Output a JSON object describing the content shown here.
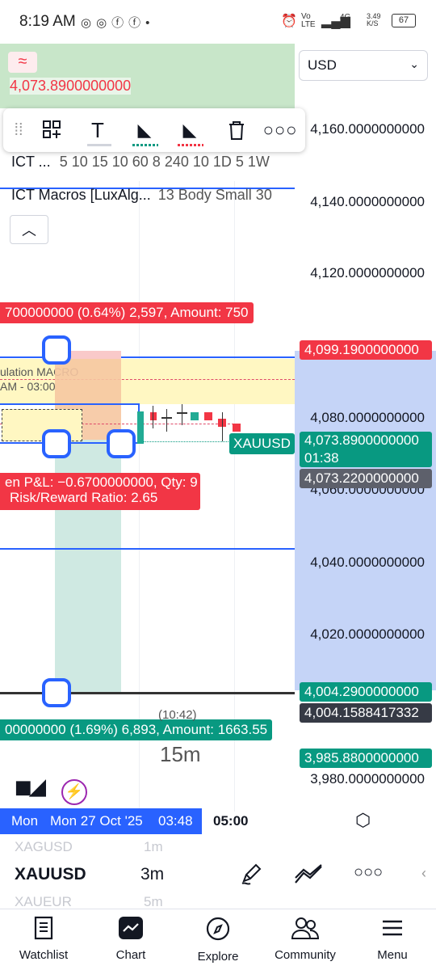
{
  "status": {
    "time": "8:19 AM",
    "network": "Vo LTE",
    "signal_type": "4G",
    "speed": "3.49 K/S",
    "battery": "67"
  },
  "chart": {
    "currency": "USD",
    "top_price_label": "4,073.8900000000",
    "indicator_row_1_name": "ICT ...",
    "indicator_row_1_params": "5 10 15 10 60 8 240 10 1D 5 1W",
    "indicator_row_2_name": "ICT Macros [LuxAlg...",
    "indicator_row_2_params": "13 Body Small 30",
    "price_ticks": [
      "4,160.0000000000",
      "4,140.0000000000",
      "4,120.0000000000",
      "4,080.0000000000",
      "4,060.0000000000",
      "4,040.0000000000",
      "4,020.0000000000",
      "3,980.0000000000"
    ],
    "tag_target": "4,099.1900000000",
    "tag_last": "4,073.8900000000",
    "tag_countdown": "01:38",
    "tag_entry": "4,073.2200000000",
    "tag_stop": "4,004.2900000000",
    "tag_stop_calc": "4,004.1588417332",
    "tag_low": "3,985.8800000000",
    "symbol_chip": "XAUUSD",
    "target_label": "700000000 (0.64%) 2,597, Amount: 750",
    "pnl_line_1": "en P&L: −0.6700000000, Qty: 9",
    "pnl_line_2": "Risk/Reward Ratio: 2.65",
    "stop_label": "00000000 (1.69%) 6,893, Amount: 1663.55",
    "macro_line_1": "ulation MACRO",
    "macro_line_2": "AM - 03:00",
    "timer_small": "(10:42)",
    "interval_watermark": "15m",
    "time_axis_1": "Mon",
    "time_axis_2": "Mon 27 Oct '25",
    "time_axis_3": "03:48",
    "time_axis_4": "05:00"
  },
  "symbol_bar": {
    "prev_symbol": "XAGUSD",
    "prev_interval": "1m",
    "symbol": "XAUUSD",
    "interval": "3m",
    "next_symbol": "XAUEUR",
    "next_interval": "5m"
  },
  "nav": [
    {
      "label": "Watchlist",
      "icon": "watchlist-icon"
    },
    {
      "label": "Chart",
      "icon": "chart-icon"
    },
    {
      "label": "Explore",
      "icon": "compass-icon"
    },
    {
      "label": "Community",
      "icon": "community-icon"
    },
    {
      "label": "Menu",
      "icon": "menu-icon"
    }
  ],
  "colors": {
    "accent_blue": "#2962ff",
    "bear_red": "#f23645",
    "bull_green": "#089981",
    "profit_zone": "#c8e6c9",
    "price_axis_zone": "#c5d4f7"
  }
}
